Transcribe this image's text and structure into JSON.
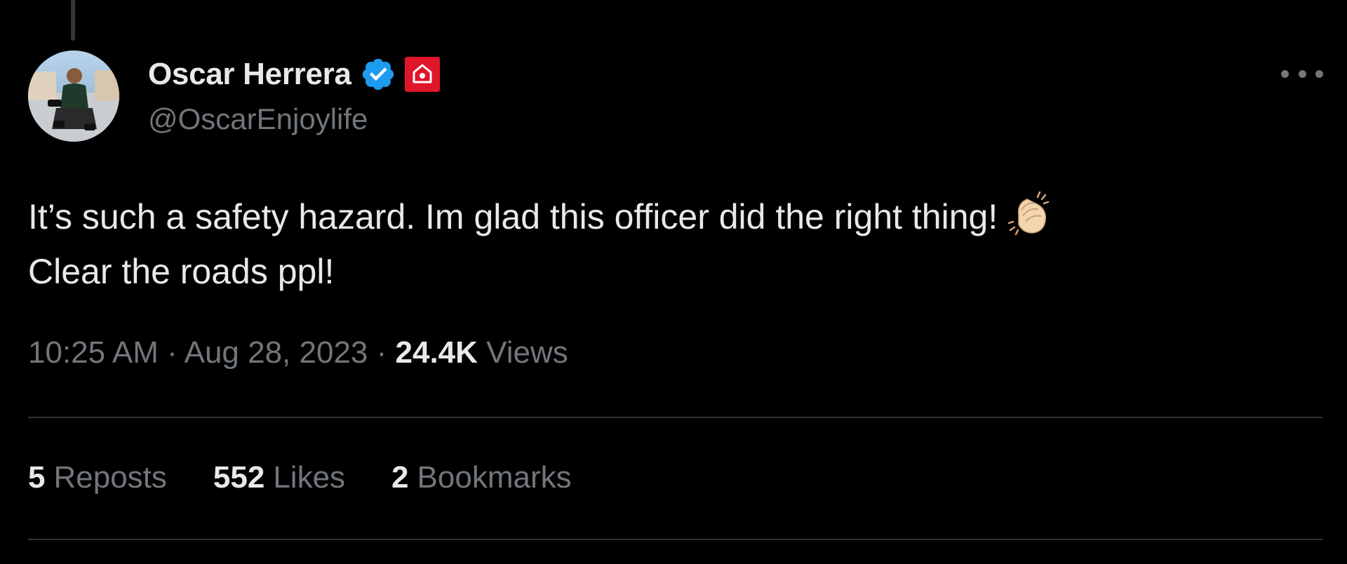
{
  "tweet": {
    "author": {
      "display_name": "Oscar Herrera",
      "handle": "@OscarEnjoylife",
      "verified": true,
      "verified_icon": "verified-badge-icon",
      "affiliate_icon": "affiliate-badge-icon",
      "avatar": "profile-photo"
    },
    "text_lines": [
      "It’s such a safety hazard. Im glad this officer did the right thing!",
      "Clear the roads ppl!"
    ],
    "emoji": "clapping-hands-icon",
    "time": "10:25 AM",
    "separator": "·",
    "date": "Aug 28, 2023",
    "views_count": "24.4K",
    "views_label": "Views",
    "stats": [
      {
        "count": "5",
        "label": "Reposts"
      },
      {
        "count": "552",
        "label": "Likes"
      },
      {
        "count": "2",
        "label": "Bookmarks"
      }
    ],
    "more_icon": "more-options-icon"
  },
  "colors": {
    "background": "#000000",
    "primary_text": "#e7e9ea",
    "secondary_text": "#71767b",
    "divider": "#2f3336",
    "verified_blue": "#1d9bf0",
    "affiliate_red": "#e0162b"
  }
}
